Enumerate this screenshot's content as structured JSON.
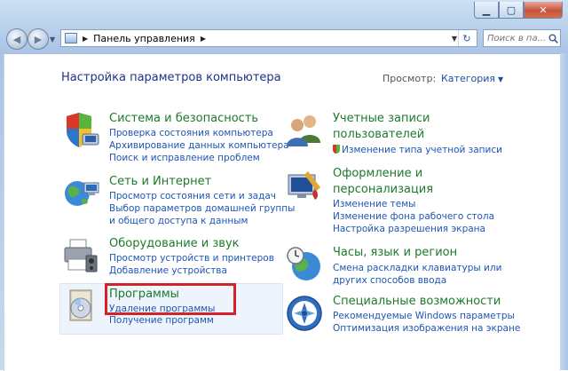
{
  "window": {
    "minimize_glyph": "▁",
    "maximize_glyph": "▢",
    "close_glyph": "✕"
  },
  "nav": {
    "address_text": "Панель управления",
    "search_placeholder": "Поиск в па..."
  },
  "page": {
    "heading": "Настройка параметров компьютера",
    "view_label": "Просмотр:",
    "view_value": "Категория"
  },
  "categories": {
    "system": {
      "title": "Система и безопасность",
      "links": [
        "Проверка состояния компьютера",
        "Архивирование данных компьютера",
        "Поиск и исправление проблем"
      ]
    },
    "network": {
      "title": "Сеть и Интернет",
      "links": [
        "Просмотр состояния сети и задач",
        "Выбор параметров домашней группы",
        "и общего доступа к данным"
      ]
    },
    "hardware": {
      "title": "Оборудование и звук",
      "links": [
        "Просмотр устройств и принтеров",
        "Добавление устройства"
      ]
    },
    "programs": {
      "title": "Программы",
      "links": [
        "Удаление программы",
        "Получение программ"
      ]
    },
    "users": {
      "title_line1": "Учетные записи",
      "title_line2": "пользователей",
      "links": [
        "Изменение типа учетной записи"
      ]
    },
    "appearance": {
      "title_line1": "Оформление и",
      "title_line2": "персонализация",
      "links": [
        "Изменение темы",
        "Изменение фона рабочего стола",
        "Настройка разрешения экрана"
      ]
    },
    "clock": {
      "title": "Часы, язык и регион",
      "links": [
        "Смена раскладки клавиатуры или",
        "других способов ввода"
      ]
    },
    "access": {
      "title": "Специальные возможности",
      "links": [
        "Рекомендуемые Windows параметры",
        "Оптимизация изображения на экране"
      ]
    }
  },
  "colors": {
    "category_title": "#1c7a2a",
    "link": "#1f55b5",
    "heading": "#1e3287",
    "highlight_box": "#d2232a"
  }
}
